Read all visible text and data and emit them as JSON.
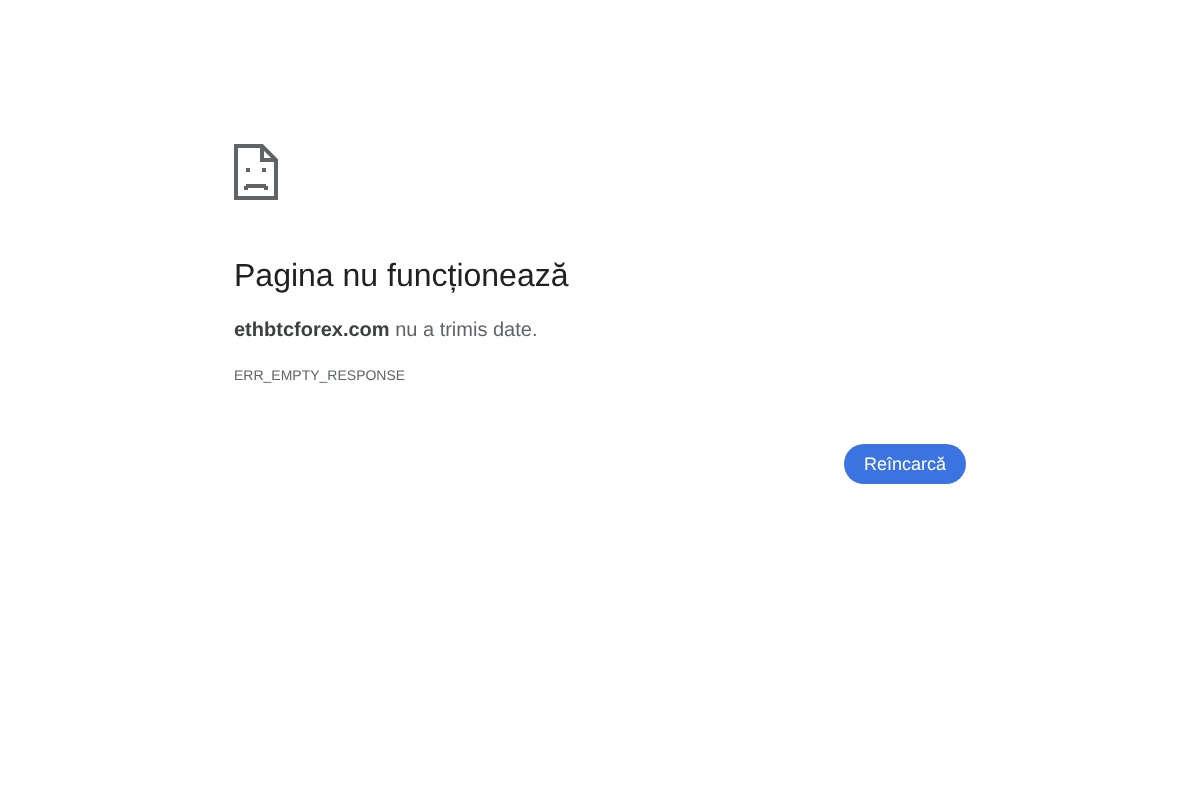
{
  "title": "Pagina nu funcționează",
  "message": "**ethbtcforex.com** nu a trimis date.",
  "error_code": "ERR_EMPTY_RESPONSE",
  "button": "Reîncarcă"
}
